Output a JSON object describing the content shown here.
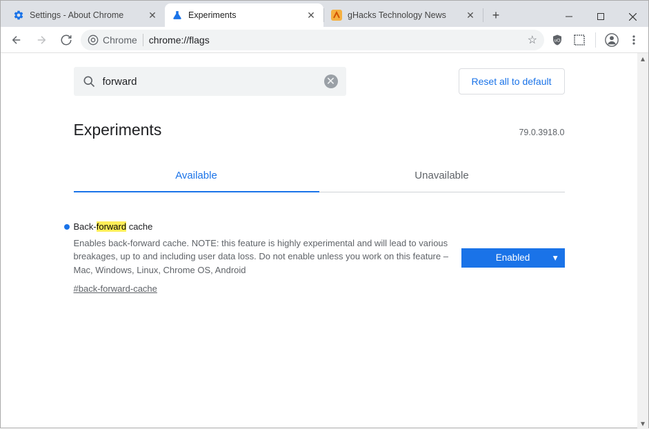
{
  "tabs": [
    {
      "label": "Settings - About Chrome"
    },
    {
      "label": "Experiments"
    },
    {
      "label": "gHacks Technology News"
    }
  ],
  "omnibox": {
    "chip": "Chrome",
    "url": "chrome://flags"
  },
  "page": {
    "title": "Experiments",
    "version": "79.0.3918.0",
    "search_value": "forward",
    "reset_label": "Reset all to default",
    "tab_available": "Available",
    "tab_unavailable": "Unavailable"
  },
  "flag": {
    "title_pre": "Back-",
    "title_hl": "forward",
    "title_post": " cache",
    "desc": "Enables back-forward cache. NOTE: this feature is highly experimental and will lead to various breakages, up to and including user data loss. Do not enable unless you work on this feature – Mac, Windows, Linux, Chrome OS, Android",
    "hash": "#back-forward-cache",
    "dropdown_value": "Enabled"
  }
}
